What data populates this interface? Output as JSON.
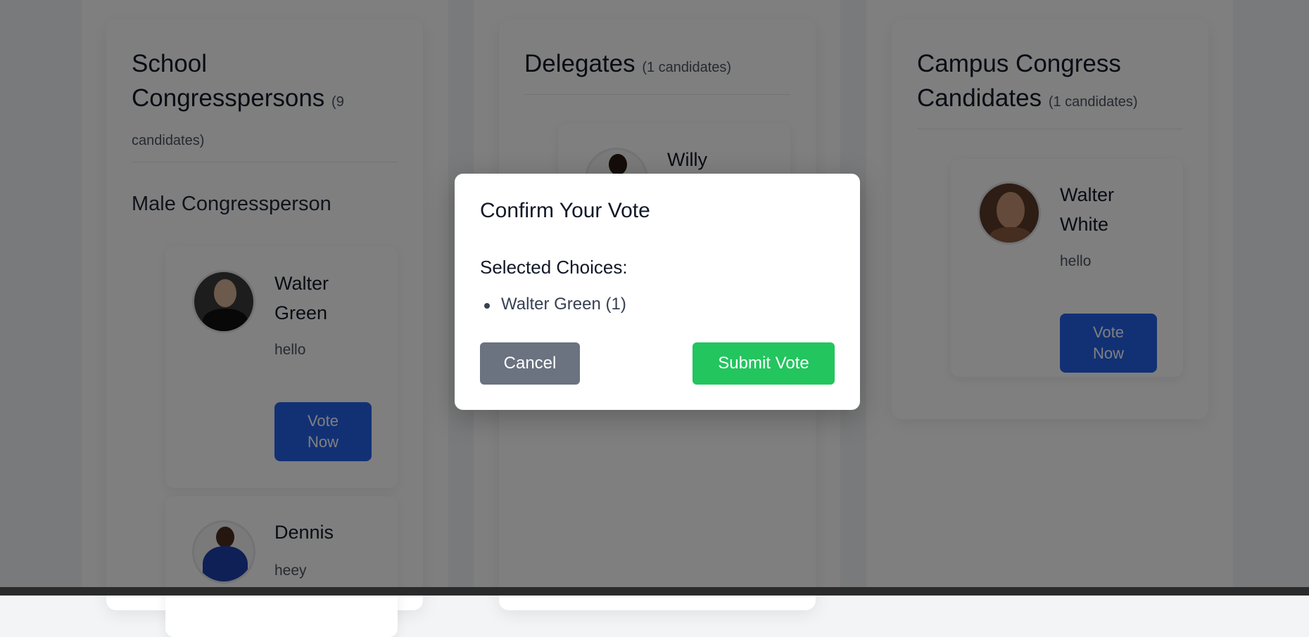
{
  "colors": {
    "primary_button": "#2563eb",
    "submit_button": "#22c55e",
    "cancel_button": "#6b7280",
    "overlay": "rgba(0,0,0,0.5)"
  },
  "sections": [
    {
      "title": "School Congresspersons",
      "count": "(9 candidates)",
      "subheading": "Male Congressperson",
      "candidates": [
        {
          "name_line1": "Walter",
          "name_line2": "Green",
          "bio": "hello",
          "vote_label_1": "Vote",
          "vote_label_2": "Now"
        },
        {
          "name_line1": "Dennis",
          "bio": "heey"
        }
      ]
    },
    {
      "title": "Delegates",
      "count": "(1 candidates)",
      "candidates": [
        {
          "name_line1": "Willy"
        }
      ]
    },
    {
      "title_line1": "Campus Congress",
      "title_line2": "Candidates",
      "count": "(1 candidates)",
      "candidates": [
        {
          "name_line1": "Walter",
          "name_line2": "White",
          "bio": "hello",
          "vote_label_1": "Vote",
          "vote_label_2": "Now"
        }
      ]
    }
  ],
  "modal": {
    "title": "Confirm Your Vote",
    "selected_heading": "Selected Choices:",
    "choices": [
      "Walter Green (1)"
    ],
    "cancel_label": "Cancel",
    "submit_label": "Submit Vote"
  }
}
